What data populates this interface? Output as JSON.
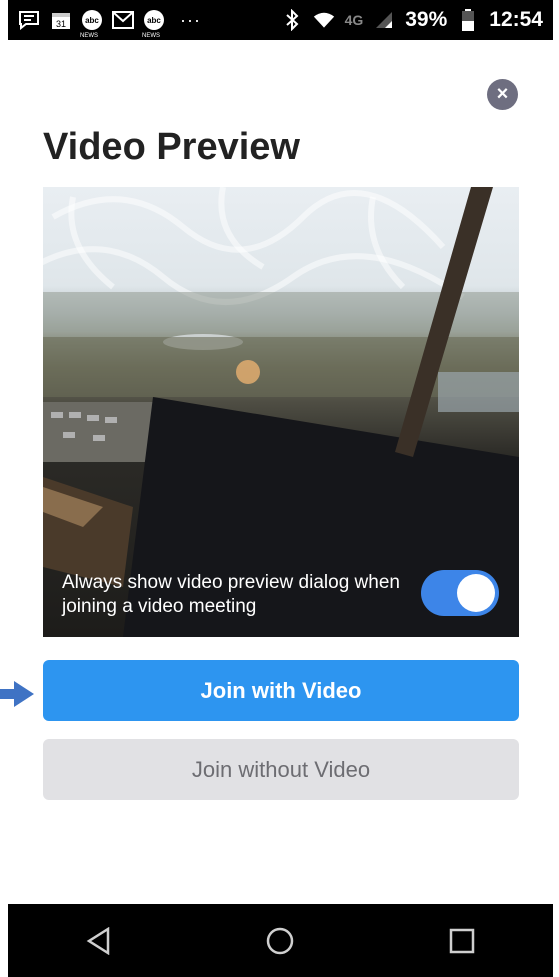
{
  "status_bar": {
    "calendar_day": "31",
    "news_label": "abc",
    "dots": "···",
    "network": "4G",
    "battery_percent": "39%",
    "time": "12:54"
  },
  "dialog": {
    "title": "Video Preview",
    "close_label": "×",
    "preview_toggle_label": "Always show video preview dialog when joining a video meeting",
    "preview_toggle_on": true,
    "join_with_video_label": "Join with Video",
    "join_without_video_label": "Join without Video"
  },
  "colors": {
    "primary_button": "#2d95f0",
    "secondary_button": "#e1e1e4",
    "toggle_on": "#3d85e8",
    "arrow": "#3f73c4"
  }
}
